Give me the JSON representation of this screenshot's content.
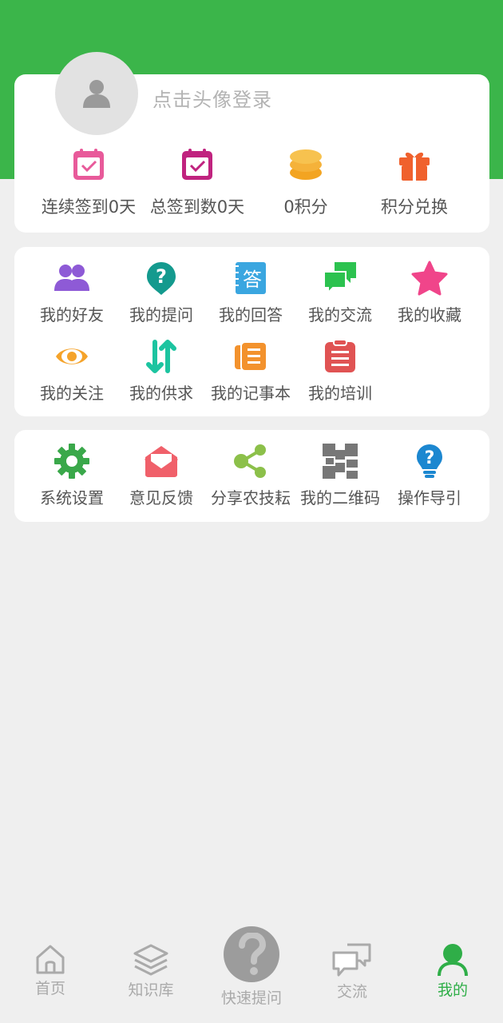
{
  "profile": {
    "login_prompt": "点击头像登录"
  },
  "stats": [
    {
      "label": "连续签到0天",
      "icon": "calendar-check-icon",
      "color": "#e85a9a"
    },
    {
      "label": "总签到数0天",
      "icon": "calendar-check-icon",
      "color": "#c0237f"
    },
    {
      "label": "0积分",
      "icon": "coin-stack-icon",
      "color": "#f5ab2a"
    },
    {
      "label": "积分兑换",
      "icon": "gift-icon",
      "color": "#f0612d"
    }
  ],
  "menu1": [
    {
      "label": "我的好友",
      "icon": "friends-icon",
      "color": "#8e5ad6"
    },
    {
      "label": "我的提问",
      "icon": "question-pin-icon",
      "color": "#149a8e"
    },
    {
      "label": "我的回答",
      "icon": "answer-book-icon",
      "color": "#3aa6e0",
      "glyph": "答"
    },
    {
      "label": "我的交流",
      "icon": "chat-bubbles-icon",
      "color": "#2cc24f"
    },
    {
      "label": "我的收藏",
      "icon": "star-icon",
      "color": "#f0458a"
    },
    {
      "label": "我的关注",
      "icon": "eye-icon",
      "color": "#f5a32a"
    },
    {
      "label": "我的供求",
      "icon": "swap-arrows-icon",
      "color": "#1cc4a0"
    },
    {
      "label": "我的记事本",
      "icon": "notebook-icon",
      "color": "#f3922d"
    },
    {
      "label": "我的培训",
      "icon": "clipboard-icon",
      "color": "#e05353"
    }
  ],
  "menu2": [
    {
      "label": "系统设置",
      "icon": "gear-icon",
      "color": "#3aa84a"
    },
    {
      "label": "意见反馈",
      "icon": "envelope-icon",
      "color": "#f0606a"
    },
    {
      "label": "分享农技耘",
      "icon": "share-icon",
      "color": "#8cc04a"
    },
    {
      "label": "我的二维码",
      "icon": "qrcode-icon",
      "color": "#777777"
    },
    {
      "label": "操作导引",
      "icon": "lightbulb-question-icon",
      "color": "#1c87d0"
    }
  ],
  "tabbar": {
    "home": "首页",
    "knowledge": "知识库",
    "quick_ask": "快速提问",
    "exchange": "交流",
    "mine": "我的",
    "active_color": "#2fae48"
  }
}
